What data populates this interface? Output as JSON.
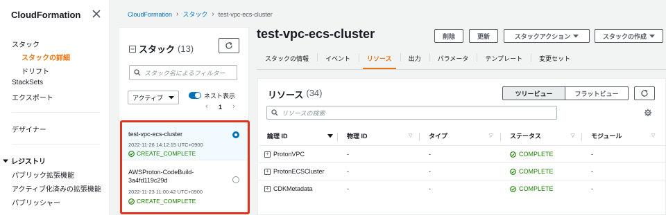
{
  "sidebar": {
    "title": "CloudFormation",
    "items": [
      {
        "label": "スタック"
      },
      {
        "label": "スタックの詳細"
      },
      {
        "label": "ドリフト"
      },
      {
        "label": "StackSets"
      },
      {
        "label": "エクスポート"
      },
      {
        "label": "デザイナー"
      }
    ],
    "registry_label": "レジストリ",
    "registry_items": [
      {
        "label": "パブリック拡張機能"
      },
      {
        "label": "アクティブ化済みの拡張機能"
      },
      {
        "label": "パブリッシャー"
      }
    ]
  },
  "breadcrumb": {
    "root": "CloudFormation",
    "section": "スタック",
    "current": "test-vpc-ecs-cluster"
  },
  "stack_list": {
    "title": "スタック",
    "count": "(13)",
    "filter_placeholder": "スタック名によるフィルター",
    "status_filter": "アクティブ",
    "nested_label": "ネスト表示",
    "page": "1",
    "stacks": [
      {
        "name": "test-vpc-ecs-cluster",
        "date": "2022-11-26 14:12:15 UTC+0900",
        "status": "CREATE_COMPLETE"
      },
      {
        "name": "AWSProton-CodeBuild-3a4fd119c29d",
        "date": "2022-11-23 11:00:42 UTC+0900",
        "status": "CREATE_COMPLETE"
      }
    ]
  },
  "main": {
    "title": "test-vpc-ecs-cluster",
    "buttons": {
      "delete": "削除",
      "update": "更新",
      "stack_actions": "スタックアクション",
      "create_stack": "スタックの作成"
    },
    "tabs": [
      {
        "label": "スタックの情報"
      },
      {
        "label": "イベント"
      },
      {
        "label": "リソース"
      },
      {
        "label": "出力"
      },
      {
        "label": "パラメータ"
      },
      {
        "label": "テンプレート"
      },
      {
        "label": "変更セット"
      }
    ]
  },
  "resources": {
    "title": "リソース",
    "count": "(34)",
    "tree_view": "ツリービュー",
    "flat_view": "フラットビュー",
    "search_placeholder": "リソースの検索",
    "columns": [
      "論理 ID",
      "物理 ID",
      "タイプ",
      "ステータス",
      "モジュール"
    ],
    "rows": [
      {
        "logical_id": "ProtonVPC",
        "physical_id": "-",
        "type": "-",
        "status": "COMPLETE",
        "module": "-"
      },
      {
        "logical_id": "ProtonECSCluster",
        "physical_id": "-",
        "type": "-",
        "status": "COMPLETE",
        "module": "-"
      },
      {
        "logical_id": "CDKMetadata",
        "physical_id": "-",
        "type": "-",
        "status": "COMPLETE",
        "module": "-"
      }
    ]
  },
  "colors": {
    "accent": "#ec7211",
    "link": "#0073bb",
    "success": "#1d8102",
    "highlight": "#e3321c"
  }
}
